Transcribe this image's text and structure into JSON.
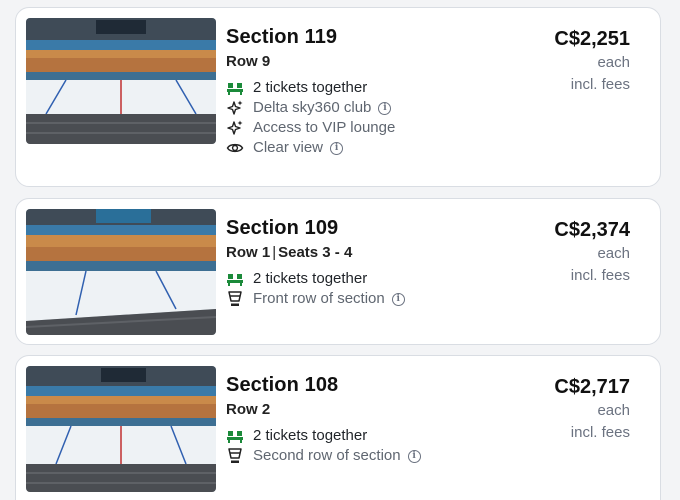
{
  "colors": {
    "ticket_icon": "#1b8a3a",
    "text_primary": "#111111",
    "text_muted": "#6b7280",
    "card_border": "#d9dde3"
  },
  "listings": [
    {
      "section": "Section 119",
      "row": "Row 9",
      "seats": "",
      "price": "C$2,251",
      "price_unit": "each",
      "price_note": "incl. fees",
      "features": [
        {
          "icon": "ticket-pair-icon",
          "text": "2 tickets together",
          "info": false
        },
        {
          "icon": "sparkle-icon",
          "text": "Delta sky360 club",
          "info": true
        },
        {
          "icon": "sparkle-icon",
          "text": "Access to VIP lounge",
          "info": false
        },
        {
          "icon": "eye-icon",
          "text": "Clear view",
          "info": true
        }
      ]
    },
    {
      "section": "Section 109",
      "row": "Row 1",
      "seats": "Seats 3 - 4",
      "price": "C$2,374",
      "price_unit": "each",
      "price_note": "incl. fees",
      "features": [
        {
          "icon": "ticket-pair-icon",
          "text": "2 tickets together",
          "info": false
        },
        {
          "icon": "cup-icon",
          "text": "Front row of section",
          "info": true
        }
      ]
    },
    {
      "section": "Section 108",
      "row": "Row 2",
      "seats": "",
      "price": "C$2,717",
      "price_unit": "each",
      "price_note": "incl. fees",
      "features": [
        {
          "icon": "ticket-pair-icon",
          "text": "2 tickets together",
          "info": false
        },
        {
          "icon": "cup-icon",
          "text": "Second row of section",
          "info": true
        }
      ]
    }
  ]
}
